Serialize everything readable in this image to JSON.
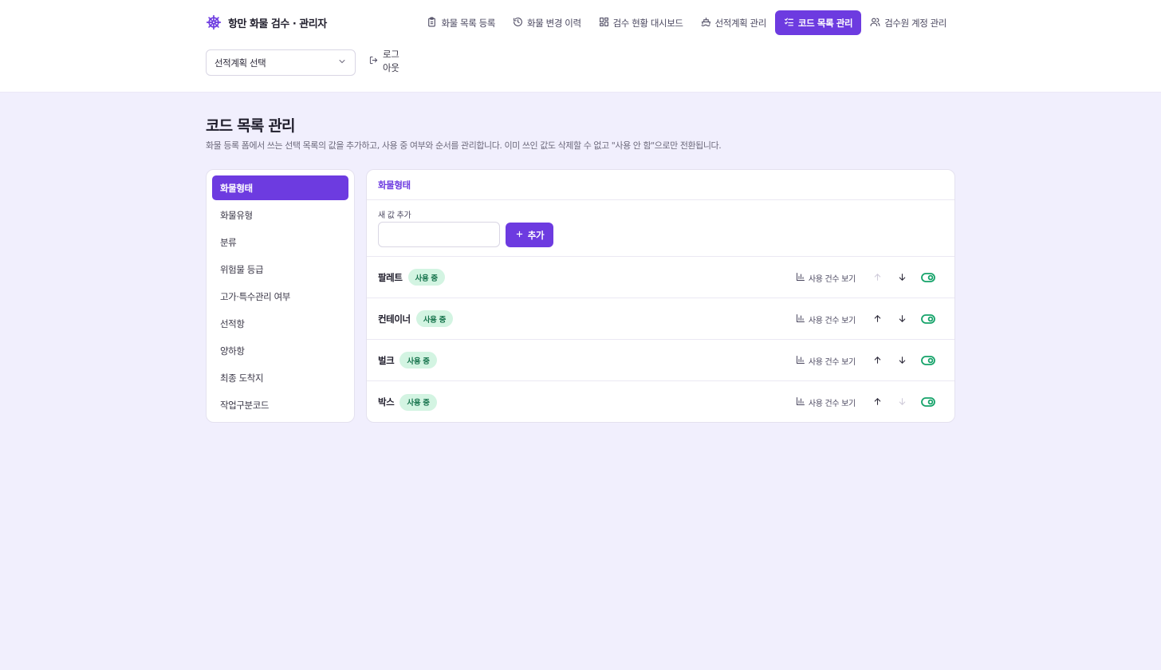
{
  "app": {
    "title": "항만 화물 검수 · 관리자",
    "accent_color": "#6d3be0",
    "logo_icon": "ship-wheel-icon"
  },
  "nav": {
    "items": [
      {
        "label": "화물 목록 등록",
        "icon": "clipboard-icon",
        "active": false
      },
      {
        "label": "화물 변경 이력",
        "icon": "history-icon",
        "active": false
      },
      {
        "label": "검수 현황 대시보드",
        "icon": "dashboard-icon",
        "active": false
      },
      {
        "label": "선적계획 관리",
        "icon": "ship-icon",
        "active": false
      },
      {
        "label": "코드 목록 관리",
        "icon": "checklist-icon",
        "active": true
      },
      {
        "label": "검수원 계정 관리",
        "icon": "users-icon",
        "active": false
      }
    ]
  },
  "plan_select": {
    "value": "선적계획 선택"
  },
  "logout": {
    "label": "로그아웃"
  },
  "page": {
    "title": "코드 목록 관리",
    "description": "화물 등록 폼에서 쓰는 선택 목록의 값을 추가하고, 사용 중 여부와 순서를 관리합니다. 이미 쓰인 값도 삭제할 수 없고 \"사용 안 함\"으로만 전환됩니다."
  },
  "categories": [
    {
      "label": "화물형태",
      "active": true
    },
    {
      "label": "화물유형",
      "active": false
    },
    {
      "label": "분류",
      "active": false
    },
    {
      "label": "위험물 등급",
      "active": false
    },
    {
      "label": "고가·특수관리 여부",
      "active": false
    },
    {
      "label": "선적항",
      "active": false
    },
    {
      "label": "양하항",
      "active": false
    },
    {
      "label": "최종 도착지",
      "active": false
    },
    {
      "label": "작업구분코드",
      "active": false
    }
  ],
  "panel": {
    "title": "화물형태",
    "add_label": "새 값 추가",
    "add_input_value": "",
    "add_button": "추가",
    "usage_label": "사용 건수 보기",
    "rows": [
      {
        "name": "팔레트",
        "status": "사용 중"
      },
      {
        "name": "컨테이너",
        "status": "사용 중"
      },
      {
        "name": "벌크",
        "status": "사용 중"
      },
      {
        "name": "박스",
        "status": "사용 중"
      }
    ]
  }
}
